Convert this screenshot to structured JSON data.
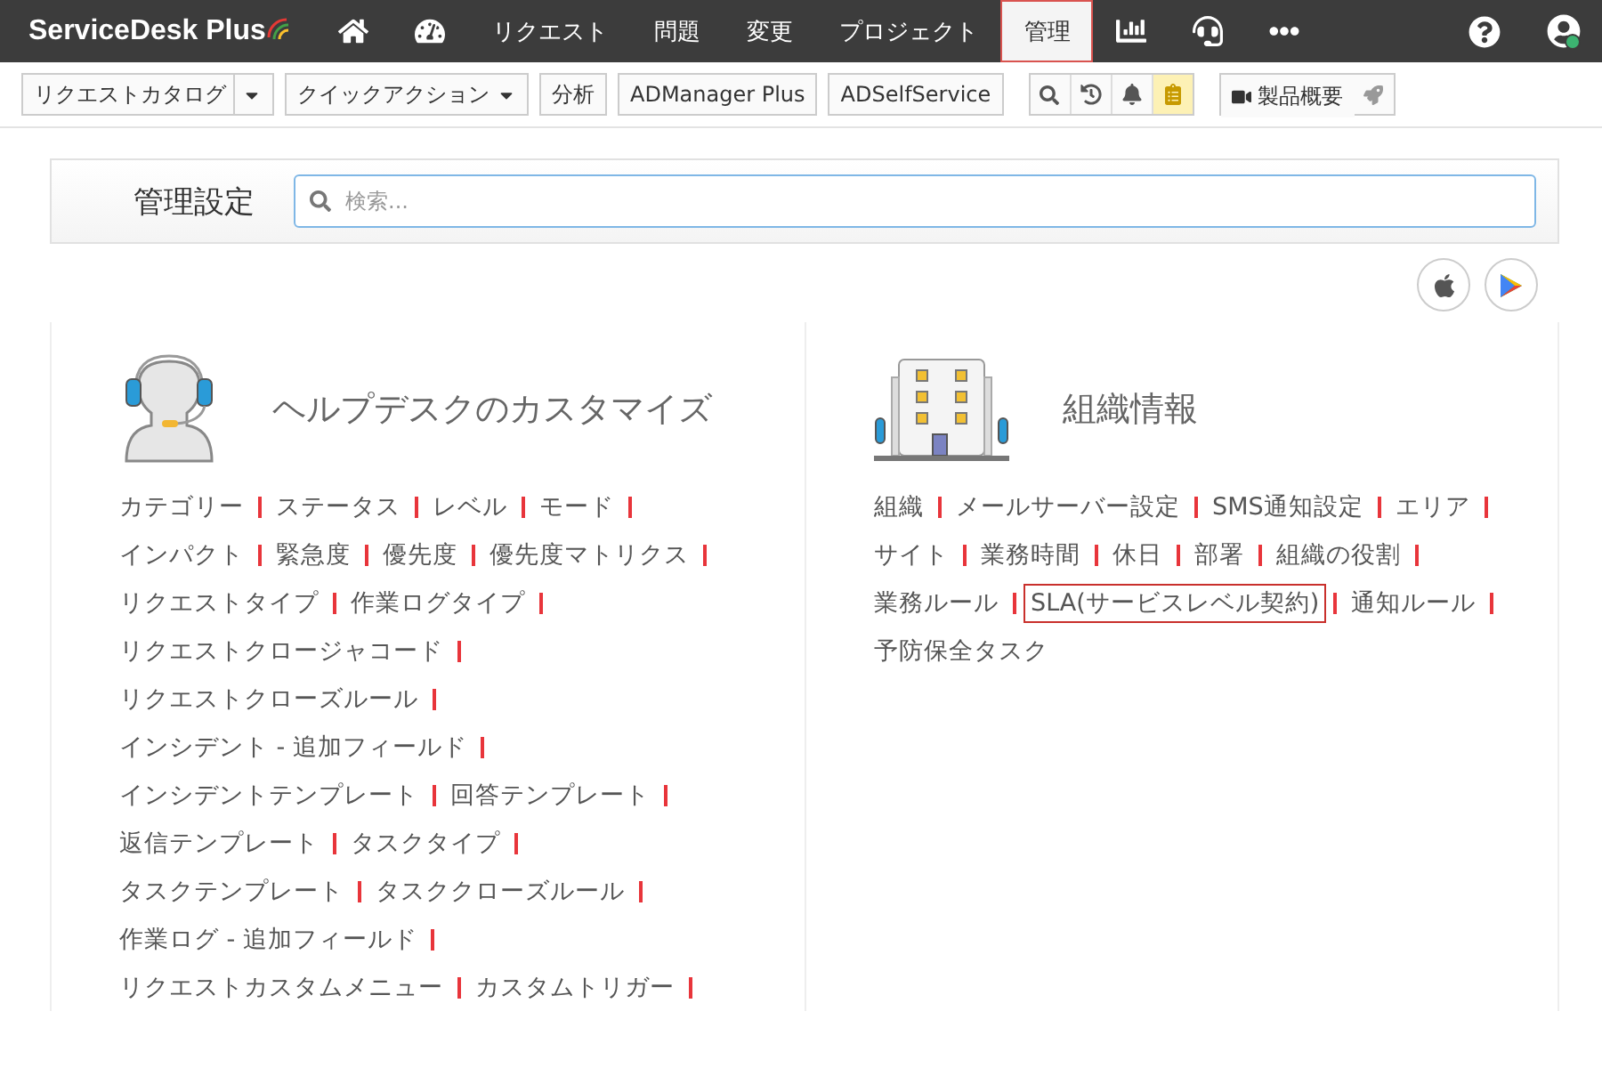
{
  "app": {
    "logo_text": "ServiceDesk Plus"
  },
  "nav": [
    {
      "kind": "home",
      "selected": false
    },
    {
      "kind": "dashboard",
      "selected": false
    },
    {
      "kind": "text",
      "label": "リクエスト",
      "selected": false
    },
    {
      "kind": "text",
      "label": "問題",
      "selected": false
    },
    {
      "kind": "text",
      "label": "変更",
      "selected": false
    },
    {
      "kind": "text",
      "label": "プロジェクト",
      "selected": false
    },
    {
      "kind": "text",
      "label": "管理",
      "selected": true
    },
    {
      "kind": "reports",
      "selected": false
    },
    {
      "kind": "support",
      "selected": false
    },
    {
      "kind": "more",
      "selected": false
    }
  ],
  "toolbar": [
    {
      "kind": "split",
      "label": "リクエストカタログ"
    },
    {
      "kind": "dropdown",
      "label": "クイックアクション"
    },
    {
      "kind": "text",
      "label": "分析"
    },
    {
      "kind": "text",
      "label": "ADManager Plus"
    },
    {
      "kind": "text",
      "label": "ADSelfService"
    },
    {
      "kind": "icons"
    },
    {
      "kind": "video",
      "label": "製品概要"
    }
  ],
  "admin": {
    "title": "管理設定",
    "search": {
      "placeholder": "検索..."
    }
  },
  "sections": [
    {
      "kind": "helpdesk",
      "title": "ヘルプデスクのカスタマイズ",
      "lines": [
        [
          {
            "label": "カテゴリー",
            "separator": true,
            "highlighted": false
          },
          {
            "label": "ステータス",
            "separator": true,
            "highlighted": false
          },
          {
            "label": "レベル",
            "separator": true,
            "highlighted": false
          },
          {
            "label": "モード",
            "separator": true,
            "highlighted": false
          }
        ],
        [
          {
            "label": "インパクト",
            "separator": true,
            "highlighted": false
          },
          {
            "label": "緊急度",
            "separator": true,
            "highlighted": false
          },
          {
            "label": "優先度",
            "separator": true,
            "highlighted": false
          },
          {
            "label": "優先度マトリクス",
            "separator": true,
            "highlighted": false
          }
        ],
        [
          {
            "label": "リクエストタイプ",
            "separator": true,
            "highlighted": false
          },
          {
            "label": "作業ログタイプ",
            "separator": true,
            "highlighted": false
          }
        ],
        [
          {
            "label": "リクエストクロージャコード",
            "separator": true,
            "highlighted": false
          }
        ],
        [
          {
            "label": "リクエストクローズルール",
            "separator": true,
            "highlighted": false
          }
        ],
        [
          {
            "label": "インシデント - 追加フィールド",
            "separator": true,
            "highlighted": false
          }
        ],
        [
          {
            "label": "インシデントテンプレート",
            "separator": true,
            "highlighted": false
          },
          {
            "label": "回答テンプレート",
            "separator": true,
            "highlighted": false
          }
        ],
        [
          {
            "label": "返信テンプレート",
            "separator": true,
            "highlighted": false
          },
          {
            "label": "タスクタイプ",
            "separator": true,
            "highlighted": false
          }
        ],
        [
          {
            "label": "タスクテンプレート",
            "separator": true,
            "highlighted": false
          },
          {
            "label": "タスククローズルール",
            "separator": true,
            "highlighted": false
          }
        ],
        [
          {
            "label": "作業ログ - 追加フィールド",
            "separator": true,
            "highlighted": false
          }
        ],
        [
          {
            "label": "リクエストカスタムメニュー",
            "separator": true,
            "highlighted": false
          },
          {
            "label": "カスタムトリガー",
            "separator": true,
            "highlighted": false
          }
        ]
      ]
    },
    {
      "kind": "organization",
      "title": "組織情報",
      "lines": [
        [
          {
            "label": "組織",
            "separator": true,
            "highlighted": false
          },
          {
            "label": "メールサーバー設定",
            "separator": true,
            "highlighted": false
          },
          {
            "label": "SMS通知設定",
            "separator": true,
            "highlighted": false
          },
          {
            "label": "エリア",
            "separator": true,
            "highlighted": false
          }
        ],
        [
          {
            "label": "サイト",
            "separator": true,
            "highlighted": false
          },
          {
            "label": "業務時間",
            "separator": true,
            "highlighted": false
          },
          {
            "label": "休日",
            "separator": true,
            "highlighted": false
          },
          {
            "label": "部署",
            "separator": true,
            "highlighted": false
          },
          {
            "label": "組織の役割",
            "separator": true,
            "highlighted": false
          }
        ],
        [
          {
            "label": "業務ルール",
            "separator": true,
            "highlighted": false
          },
          {
            "label": "SLA(サービスレベル契約)",
            "separator": true,
            "highlighted": true
          },
          {
            "label": "通知ルール",
            "separator": true,
            "highlighted": false
          }
        ],
        [
          {
            "label": "予防保全タスク",
            "separator": false,
            "highlighted": false
          }
        ]
      ]
    }
  ]
}
